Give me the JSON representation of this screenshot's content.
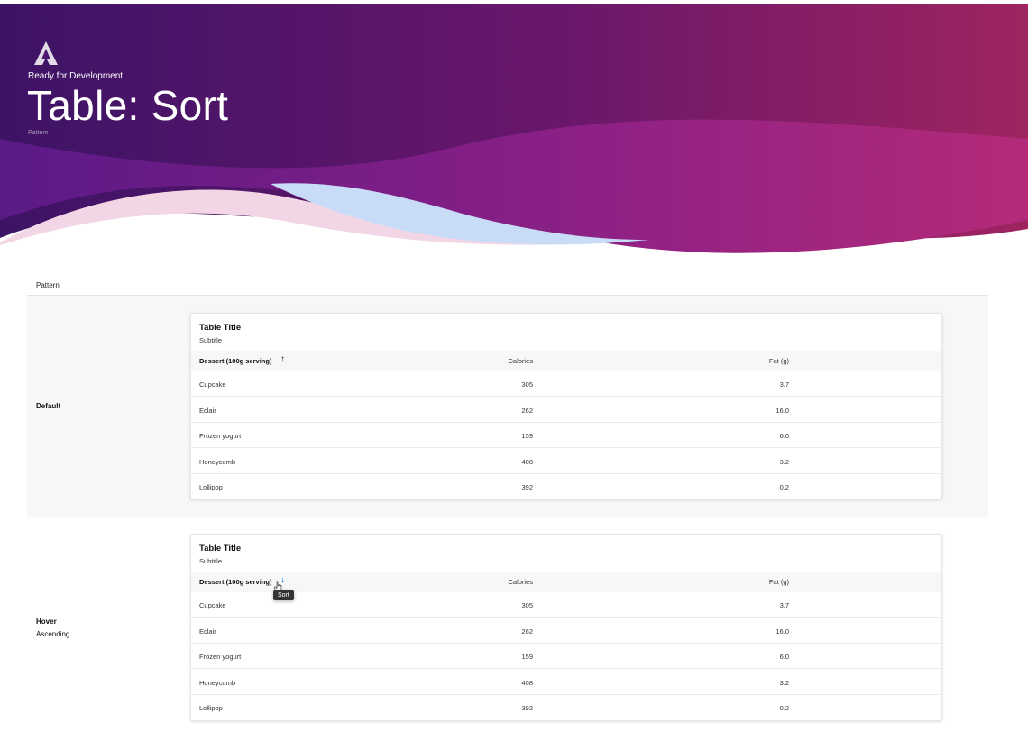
{
  "header": {
    "status": "Ready for Development",
    "title": "Table: Sort",
    "category": "Pattern",
    "logo_icon": "triangle-a-logo-icon"
  },
  "section": {
    "label": "Pattern"
  },
  "columns": [
    "Dessert (100g serving)",
    "Calories",
    "Fat (g)"
  ],
  "rows": [
    {
      "name": "Cupcake",
      "calories": "305",
      "fat": "3.7"
    },
    {
      "name": "Eclair",
      "calories": "262",
      "fat": "16.0"
    },
    {
      "name": "Frozen yogurt",
      "calories": "159",
      "fat": "6.0"
    },
    {
      "name": "Honeycomb",
      "calories": "408",
      "fat": "3.2"
    },
    {
      "name": "Lollipop",
      "calories": "392",
      "fat": "0.2"
    }
  ],
  "variants": {
    "default": {
      "label": "Default",
      "card_title": "Table Title",
      "card_subtitle": "Subtitle",
      "sort_icon": "arrow-up-icon"
    },
    "hover": {
      "label": "Hover",
      "sublabel": "Ascending",
      "card_title": "Table Title",
      "card_subtitle": "Subtitle",
      "sort_icon": "arrow-down-icon",
      "tooltip": "Sort"
    }
  },
  "colors": {
    "hero_start": "#3f1467",
    "hero_end": "#9c2360",
    "wave_purple": "#7a1f86",
    "wave_magenta": "#b02a7c",
    "wave_blue": "#c8dcf7",
    "wave_pink": "#f3d6e6",
    "sort_active": "#1a73e8"
  }
}
